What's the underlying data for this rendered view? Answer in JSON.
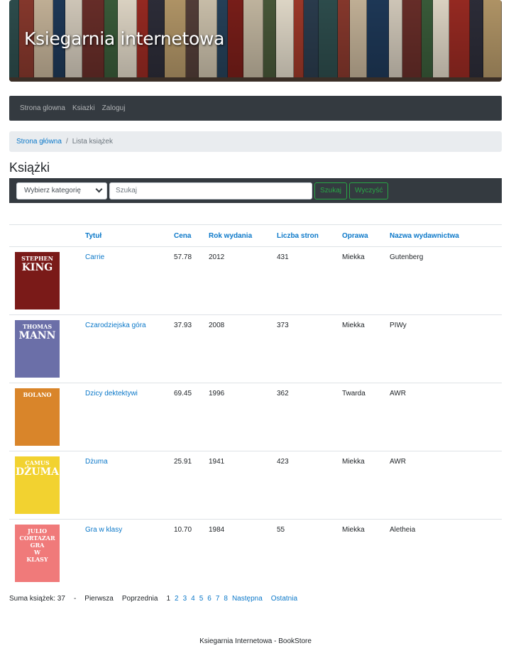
{
  "header": {
    "title": "Ksiegarnia internetowa"
  },
  "nav": {
    "items": [
      "Strona glowna",
      "Ksiazki",
      "Zaloguj"
    ]
  },
  "breadcrumb": {
    "home": "Strona główna",
    "current": "Lista książek"
  },
  "page": {
    "title": "Książki"
  },
  "filters": {
    "category_selected": "Wybierz kategorię",
    "search_placeholder": "Szukaj",
    "search_button": "Szukaj",
    "clear_button": "Wyczyść",
    "accent": "#28a745"
  },
  "table": {
    "headers": [
      "Tytuł",
      "Cena",
      "Rok wydania",
      "Liczba stron",
      "Oprawa",
      "Nazwa wydawnictwa"
    ],
    "rows": [
      {
        "title": "Carrie",
        "price": "57.78",
        "year": "2012",
        "pages": "431",
        "binding": "Miekka",
        "publisher": "Gutenberg",
        "cover": {
          "bg": "#7a1a18",
          "lines": [
            "STEPHEN",
            "KING"
          ]
        }
      },
      {
        "title": "Czarodziejska góra",
        "price": "37.93",
        "year": "2008",
        "pages": "373",
        "binding": "Miekka",
        "publisher": "PIWy",
        "cover": {
          "bg": "#6b6fa8",
          "lines": [
            "THOMAS",
            "MANN"
          ]
        }
      },
      {
        "title": "Dzicy dektektywi",
        "price": "69.45",
        "year": "1996",
        "pages": "362",
        "binding": "Twarda",
        "publisher": "AWR",
        "cover": {
          "bg": "#d9852a",
          "lines": [
            "BOLANO"
          ]
        }
      },
      {
        "title": "Dżuma",
        "price": "25.91",
        "year": "1941",
        "pages": "423",
        "binding": "Miekka",
        "publisher": "AWR",
        "cover": {
          "bg": "#f2d230",
          "lines": [
            "CAMUS",
            "DŻUMA"
          ]
        }
      },
      {
        "title": "Gra w klasy",
        "price": "10.70",
        "year": "1984",
        "pages": "55",
        "binding": "Miekka",
        "publisher": "Aletheia",
        "cover": {
          "bg": "#f07a7a",
          "lines": [
            "JULIO",
            "CORTAZAR",
            "GRA",
            "W",
            "KLASY"
          ]
        }
      }
    ]
  },
  "pagination": {
    "total_label": "Suma książek: 37",
    "dash": "-",
    "first": "Pierwsza",
    "prev": "Poprzednia",
    "current": "1",
    "pages": [
      "2",
      "3",
      "4",
      "5",
      "6",
      "7",
      "8"
    ],
    "next": "Następna",
    "last": "Ostatnia"
  },
  "footer": {
    "text": "Ksiegarnia Internetowa - BookStore"
  }
}
